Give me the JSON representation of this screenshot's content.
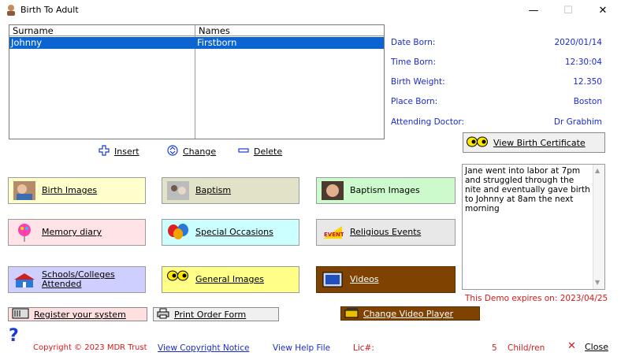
{
  "window": {
    "title": "Birth To Adult",
    "minimize": "—",
    "maximize": "☐",
    "close": "✕"
  },
  "grid": {
    "headers": [
      "Surname",
      "Names"
    ],
    "rows": [
      {
        "surname": "Johnny",
        "names": "Firstborn"
      }
    ]
  },
  "details": [
    {
      "label": "Date Born:",
      "value": "2020/01/14"
    },
    {
      "label": "Time Born:",
      "value": "12:30:04"
    },
    {
      "label": "Birth Weight:",
      "value": "12.350"
    },
    {
      "label": "Place Born:",
      "value": "Boston"
    },
    {
      "label": "Attending Doctor:",
      "value": "Dr Grabhim"
    }
  ],
  "actions": {
    "insert": "Insert",
    "change": "Change",
    "delete": "Delete"
  },
  "certificate_button": "View Birth Certificate",
  "categories": {
    "birth_images": "Birth Images",
    "baptism": "Baptism",
    "baptism_images": "Baptism Images",
    "memory_diary": "Memory diary",
    "special_occasions": "Special Occasions",
    "religious_events": "Religious Events",
    "schools_1": "Schools/Colleges",
    "schools_2": "Attended",
    "general_images": "General Images",
    "videos": "Videos"
  },
  "notes": "Jane went into labor at 7pm and struggled through the nite and eventually gave birth to Johnny at 8am the next morning",
  "demo_expiry": "This Demo expires on: 2023/04/25",
  "bottom_buttons": {
    "register": "Register your system",
    "print_order": "Print Order Form",
    "change_player": "Change Video Player"
  },
  "footer": {
    "copyright": "Copyright © 2023 MDR Trust",
    "copyright_notice": "View Copyright Notice",
    "help": "View Help File",
    "lic": "Lic#:",
    "child_count": "5",
    "child_label": "Child/ren",
    "close": "Close"
  },
  "colors": {
    "selection": "#0a64d2",
    "info_text": "#1a2bd1",
    "footer_red": "#d11b1b",
    "birth_images_bg": "#ffffcc",
    "baptism_bg": "#e2e2c8",
    "baptism_images_bg": "#cdfacd",
    "memory_bg": "#ffe3e6",
    "special_bg": "#ccffff",
    "religious_bg": "#e8e8e8",
    "schools_bg": "#cfcfff",
    "general_bg": "#ffff88",
    "videos_bg": "#7f4200"
  }
}
